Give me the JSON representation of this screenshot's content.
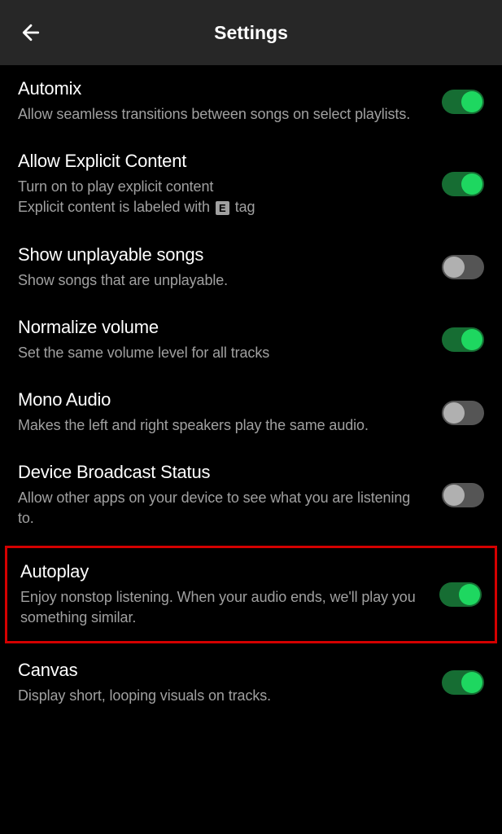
{
  "header": {
    "title": "Settings"
  },
  "settings": {
    "automix": {
      "title": "Automix",
      "desc": "Allow seamless transitions between songs on select playlists.",
      "on": true
    },
    "explicit": {
      "title": "Allow Explicit Content",
      "desc_pre": "Turn on to play explicit content",
      "desc_post_pre": "Explicit content is labeled with ",
      "desc_post_tag": "E",
      "desc_post_suffix": " tag",
      "on": true
    },
    "unplayable": {
      "title": "Show unplayable songs",
      "desc": "Show songs that are unplayable.",
      "on": false
    },
    "normalize": {
      "title": "Normalize volume",
      "desc": "Set the same volume level for all tracks",
      "on": true
    },
    "mono": {
      "title": "Mono Audio",
      "desc": "Makes the left and right speakers play the same audio.",
      "on": false
    },
    "broadcast": {
      "title": "Device Broadcast Status",
      "desc": "Allow other apps on your device to see what you are listening to.",
      "on": false
    },
    "autoplay": {
      "title": "Autoplay",
      "desc": "Enjoy nonstop listening. When your audio ends, we'll play you something similar.",
      "on": true
    },
    "canvas": {
      "title": "Canvas",
      "desc": "Display short, looping visuals on tracks.",
      "on": true
    }
  }
}
